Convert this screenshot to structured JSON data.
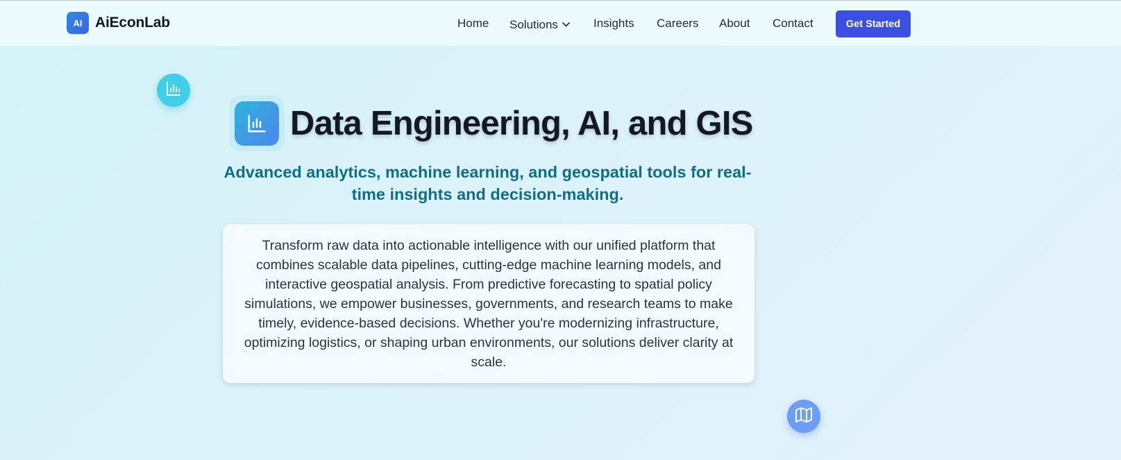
{
  "brand": {
    "badge": "AI",
    "name": "AiEconLab"
  },
  "nav": {
    "items": [
      {
        "label": "Home"
      },
      {
        "label": "Solutions"
      },
      {
        "label": "Insights"
      },
      {
        "label": "Careers"
      },
      {
        "label": "About"
      },
      {
        "label": "Contact"
      }
    ],
    "cta_label": "Get Started"
  },
  "hero": {
    "title": "Data Engineering, AI, and GIS",
    "subtitle": "Advanced analytics, machine learning, and geospatial tools for real-time insights and decision-making.",
    "description": "Transform raw data into actionable intelligence with our unified platform that combines scalable data pipelines, cutting-edge machine learning models, and interactive geospatial analysis. From predictive forecasting to spatial policy simulations, we empower businesses, governments, and research teams to make timely, evidence-based decisions. Whether you're modernizing infrastructure, optimizing logistics, or shaping urban environments, our solutions deliver clarity at scale."
  },
  "icons": {
    "left_bubble": "bar-chart-icon",
    "title_icon": "bar-chart-icon",
    "right_bubble": "map-icon"
  },
  "colors": {
    "accent": "#3b50e3",
    "subtitle": "#0e6e86",
    "title": "#121826"
  }
}
